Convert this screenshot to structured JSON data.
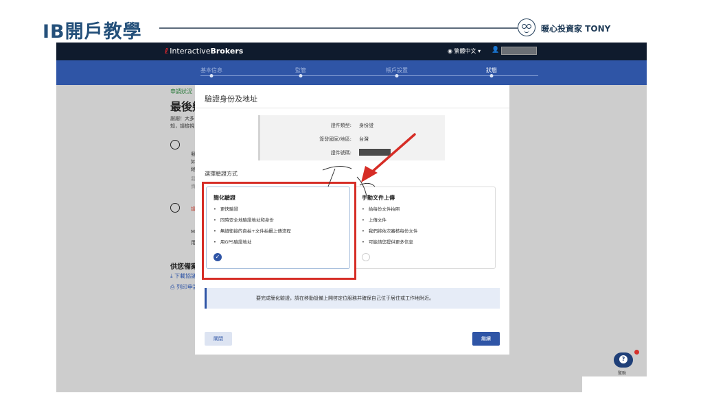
{
  "slide": {
    "title": "IB開戶教學",
    "brand": "暖心投資家 TONY"
  },
  "ib": {
    "logo_plain": "Interactive",
    "logo_bold": "Brokers",
    "language": "繁體中文 ▾",
    "steps": [
      "基本信息",
      "監管",
      "帳戶設置",
      "狀態"
    ],
    "status_label": "申請狀況",
    "heading": "最後幾",
    "thanks_line1": "謝謝！大多",
    "thanks_line2": "知，請檢視",
    "left_snippets": [
      "我",
      "如",
      "給",
      "我",
      "資",
      "請",
      "M",
      "用"
    ],
    "download_heading": "供您備案",
    "download_link": "下載協議",
    "print_link": "列印申請",
    "help_label": "幫助"
  },
  "modal": {
    "title": "驗證身份及地址",
    "id_info": [
      {
        "label": "證件類型:",
        "value": "身份證"
      },
      {
        "label": "簽發國家/地區:",
        "value": "台灣"
      },
      {
        "label": "證件號碼:",
        "value": ""
      }
    ],
    "choose_label": "選擇驗證方式",
    "options": [
      {
        "title": "簡化驗證",
        "bullets": [
          "更快驗證",
          "同時安全地驗證地址和身份",
          "無縫銜接的自拍+文件拍攝上傳流程",
          "用GPS驗證地址"
        ],
        "selected": true
      },
      {
        "title": "手動文件上傳",
        "bullets": [
          "給每份文件拍照",
          "上傳文件",
          "我們將依次審核每份文件",
          "可能請您提供更多信息"
        ],
        "selected": false
      }
    ],
    "note": "要完成簡化驗證，請在移動設備上開啓定位服務并確保自己位于居住或工作地附近。",
    "close_label": "關閉",
    "continue_label": "繼續"
  },
  "colors": {
    "slide_title": "#24507a",
    "ib_nav": "#0f1b2d",
    "ib_blue": "#2f55a6",
    "annotation_red": "#d62d26"
  },
  "icons": {
    "globe": "globe-icon",
    "user": "user-icon",
    "check": "check-circle-icon",
    "help": "help-icon",
    "download": "download-icon",
    "print": "print-icon"
  }
}
